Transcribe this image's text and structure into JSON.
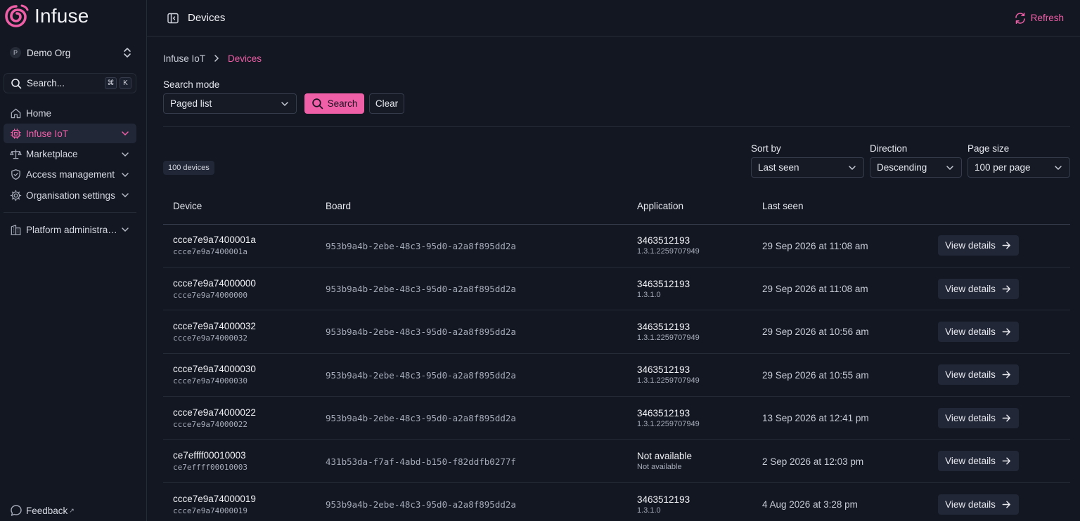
{
  "sidebar": {
    "brand": "Infuse",
    "org": {
      "avatar": "P",
      "name": "Demo Org"
    },
    "search": {
      "label": "Search...",
      "kbd1": "⌘",
      "kbd2": "K"
    },
    "nav": [
      {
        "label": "Home",
        "icon": "home-icon"
      },
      {
        "label": "Infuse IoT",
        "icon": "chip-icon",
        "active": true
      },
      {
        "label": "Marketplace",
        "icon": "scale-icon"
      },
      {
        "label": "Access management",
        "icon": "shield-icon"
      },
      {
        "label": "Organisation settings",
        "icon": "gear-icon"
      }
    ],
    "platform_admin": "Platform administration",
    "feedback": "Feedback",
    "feedback_ext": "↗"
  },
  "header": {
    "title": "Devices",
    "refresh": "Refresh"
  },
  "breadcrumb": {
    "parent": "Infuse IoT",
    "current": "Devices"
  },
  "search_mode": {
    "label": "Search mode",
    "value": "Paged list",
    "search_button": "Search",
    "clear_button": "Clear"
  },
  "list": {
    "count": "100 devices",
    "sort_by": {
      "label": "Sort by",
      "value": "Last seen"
    },
    "direction": {
      "label": "Direction",
      "value": "Descending"
    },
    "page_size": {
      "label": "Page size",
      "value": "100 per page"
    }
  },
  "table": {
    "columns": {
      "device": "Device",
      "board": "Board",
      "application": "Application",
      "last_seen": "Last seen"
    },
    "view_label": "View details",
    "rows": [
      {
        "device": "ccce7e9a7400001a",
        "device_id": "ccce7e9a7400001a",
        "board": "953b9a4b-2ebe-48c3-95d0-a2a8f895dd2a",
        "app": "3463512193",
        "app_version": "1.3.1.2259707949",
        "last_seen": "29 Sep 2026 at 11:08 am"
      },
      {
        "device": "ccce7e9a74000000",
        "device_id": "ccce7e9a74000000",
        "board": "953b9a4b-2ebe-48c3-95d0-a2a8f895dd2a",
        "app": "3463512193",
        "app_version": "1.3.1.0",
        "last_seen": "29 Sep 2026 at 11:08 am"
      },
      {
        "device": "ccce7e9a74000032",
        "device_id": "ccce7e9a74000032",
        "board": "953b9a4b-2ebe-48c3-95d0-a2a8f895dd2a",
        "app": "3463512193",
        "app_version": "1.3.1.2259707949",
        "last_seen": "29 Sep 2026 at 10:56 am"
      },
      {
        "device": "ccce7e9a74000030",
        "device_id": "ccce7e9a74000030",
        "board": "953b9a4b-2ebe-48c3-95d0-a2a8f895dd2a",
        "app": "3463512193",
        "app_version": "1.3.1.2259707949",
        "last_seen": "29 Sep 2026 at 10:55 am"
      },
      {
        "device": "ccce7e9a74000022",
        "device_id": "ccce7e9a74000022",
        "board": "953b9a4b-2ebe-48c3-95d0-a2a8f895dd2a",
        "app": "3463512193",
        "app_version": "1.3.1.2259707949",
        "last_seen": "13 Sep 2026 at 12:41 pm"
      },
      {
        "device": "ce7effff00010003",
        "device_id": "ce7effff00010003",
        "board": "431b53da-f7af-4abd-b150-f82ddfb0277f",
        "app": "Not available",
        "app_version": "Not available",
        "last_seen": "2 Sep 2026 at 12:03 pm"
      },
      {
        "device": "ccce7e9a74000019",
        "device_id": "ccce7e9a74000019",
        "board": "953b9a4b-2ebe-48c3-95d0-a2a8f895dd2a",
        "app": "3463512193",
        "app_version": "1.3.1.0",
        "last_seen": "4 Aug 2026 at 3:28 pm"
      }
    ]
  },
  "colors": {
    "accent": "#ef5fa7",
    "background": "#131722",
    "border": "#262b38"
  }
}
